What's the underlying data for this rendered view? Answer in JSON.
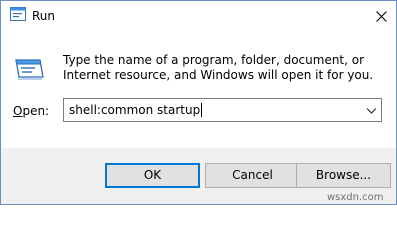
{
  "window": {
    "title": "Run",
    "title_icon": "run-app-icon",
    "close_icon": "close-icon"
  },
  "body": {
    "icon": "run-dialog-icon",
    "description": "Type the name of a program, folder, document, or Internet resource, and Windows will open it for you."
  },
  "open_field": {
    "label_mnemonic": "O",
    "label_rest": "pen:",
    "value": "shell:common startup",
    "dropdown_icon": "chevron-down-icon"
  },
  "buttons": {
    "ok": "OK",
    "cancel": "Cancel",
    "browse": "Browse..."
  },
  "watermark": "wsxdn.com",
  "colors": {
    "accent": "#0078d7",
    "footer_bg": "#f0f0f0",
    "button_bg": "#e1e1e1",
    "window_border": "#6b8fc7"
  }
}
